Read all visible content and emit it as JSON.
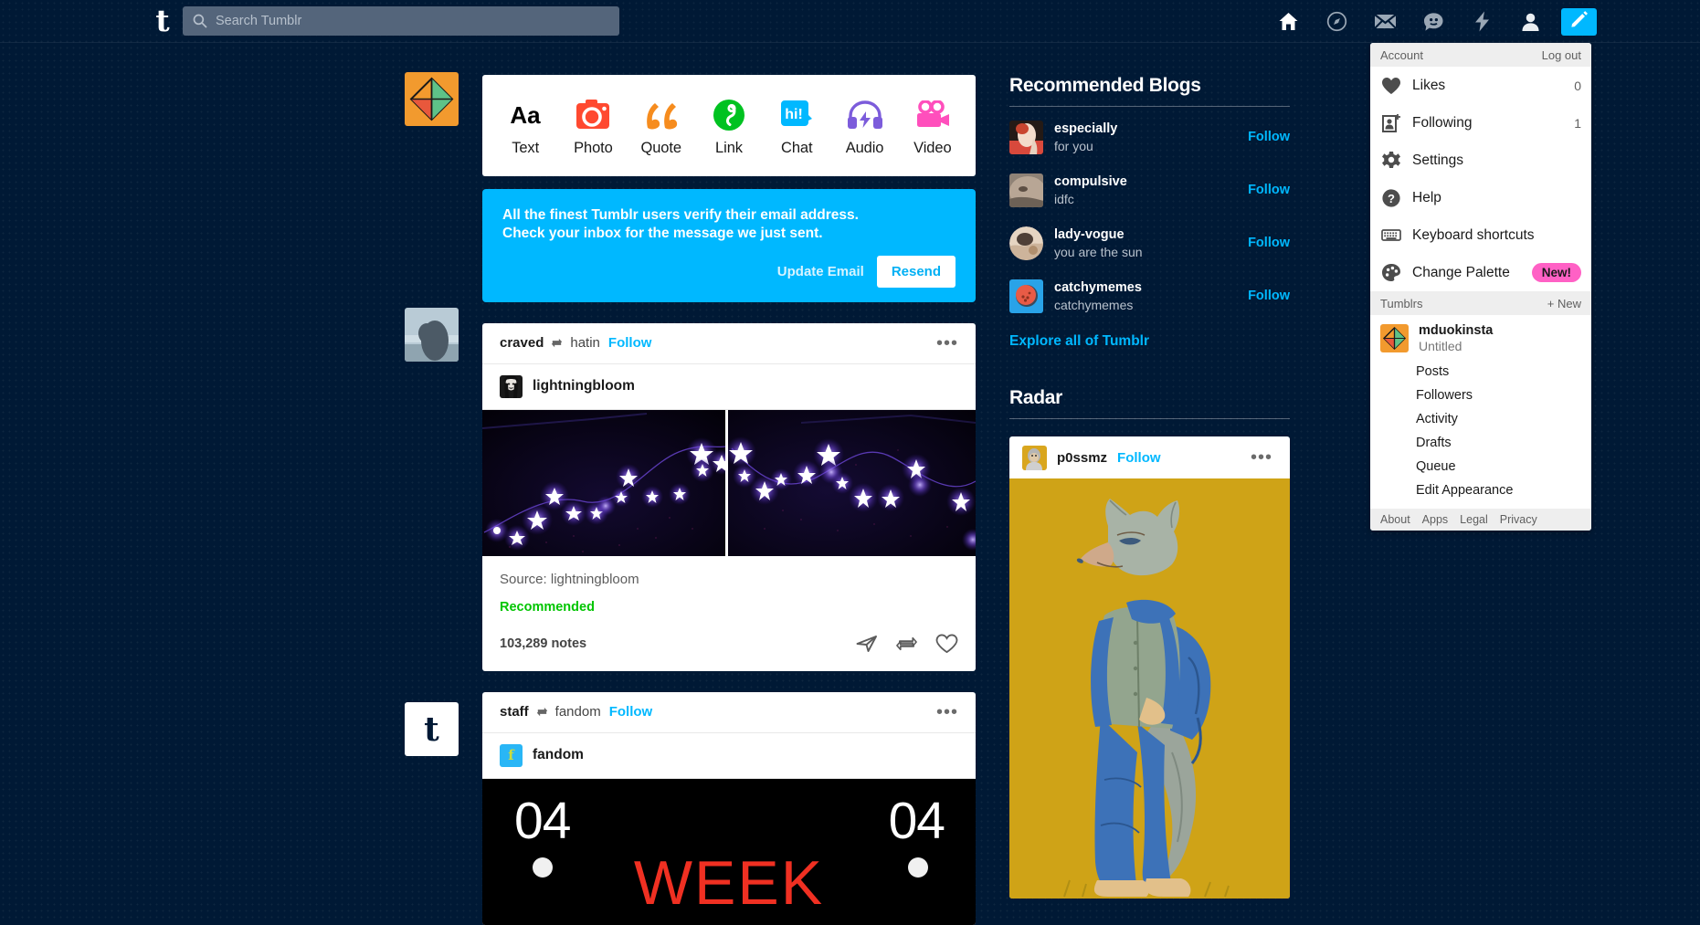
{
  "topbar": {
    "logo": "t",
    "search": {
      "placeholder": "Search Tumblr",
      "value": ""
    },
    "nav": [
      {
        "name": "home-icon",
        "label": "Home"
      },
      {
        "name": "explore-compass-icon",
        "label": "Explore"
      },
      {
        "name": "inbox-envelope-icon",
        "label": "Inbox"
      },
      {
        "name": "messaging-chat-icon",
        "label": "Messaging"
      },
      {
        "name": "activity-bolt-icon",
        "label": "Activity"
      },
      {
        "name": "account-person-icon",
        "label": "Account"
      }
    ],
    "compose_button": {
      "name": "compose-pencil-icon",
      "label": "Compose"
    }
  },
  "post_types": [
    {
      "label": "Text",
      "icon": "text-aa-icon",
      "color": "#000000"
    },
    {
      "label": "Photo",
      "icon": "photo-camera-icon",
      "color": "#ff4930"
    },
    {
      "label": "Quote",
      "icon": "quote-marks-icon",
      "color": "#f68c1e"
    },
    {
      "label": "Link",
      "icon": "link-chain-icon",
      "color": "#00c221"
    },
    {
      "label": "Chat",
      "icon": "chat-hi-icon",
      "color": "#00b8ff"
    },
    {
      "label": "Audio",
      "icon": "audio-headphones-icon",
      "color": "#7c5cdb"
    },
    {
      "label": "Video",
      "icon": "video-camera-icon",
      "color": "#ff4fbc"
    }
  ],
  "banner": {
    "message": "All the finest Tumblr users verify their email address. Check your inbox for the message we just sent.",
    "update_label": "Update Email",
    "resend_label": "Resend",
    "color": "#00b8ff"
  },
  "posts": [
    {
      "blog": "craved",
      "reblog_source": "hatin",
      "follow_label": "Follow",
      "author": "lightningbloom",
      "source_label": "Source: lightningbloom",
      "tag": "Recommended",
      "tag_color": "#00c500",
      "notes": "103,289 notes",
      "menu": "•••"
    },
    {
      "blog": "staff",
      "reblog_source": "fandom",
      "follow_label": "Follow",
      "author": "fandom",
      "image_left_number": "04",
      "image_right_number": "04",
      "image_word": "WEEK",
      "menu": "•••"
    }
  ],
  "right_column": {
    "recommended_title": "Recommended Blogs",
    "blogs": [
      {
        "name": "especially",
        "desc": "for you",
        "follow": "Follow"
      },
      {
        "name": "compulsive",
        "desc": "idfc",
        "follow": "Follow"
      },
      {
        "name": "lady-vogue",
        "desc": "you are the sun",
        "follow": "Follow"
      },
      {
        "name": "catchymemes",
        "desc": "catchymemes",
        "follow": "Follow"
      }
    ],
    "explore_link": "Explore all of Tumblr",
    "radar_title": "Radar",
    "radar": {
      "blog": "p0ssmz",
      "follow": "Follow",
      "menu": "•••"
    }
  },
  "account_menu": {
    "header_left": "Account",
    "header_right": "Log out",
    "items": [
      {
        "label": "Likes",
        "icon": "heart-icon",
        "count": "0"
      },
      {
        "label": "Following",
        "icon": "follow-person-icon",
        "count": "1"
      },
      {
        "label": "Settings",
        "icon": "gear-icon",
        "count": ""
      },
      {
        "label": "Help",
        "icon": "question-circle-icon",
        "count": ""
      },
      {
        "label": "Keyboard shortcuts",
        "icon": "keyboard-icon",
        "count": ""
      },
      {
        "label": "Change Palette",
        "icon": "palette-icon",
        "count": "",
        "badge": "New!"
      }
    ],
    "tumblrs_label": "Tumblrs",
    "new_label": "+ New",
    "blog": {
      "name": "mduokinsta",
      "title": "Untitled"
    },
    "blog_links": [
      "Posts",
      "Followers",
      "Activity",
      "Drafts",
      "Queue",
      "Edit Appearance"
    ],
    "footer_links": [
      "About",
      "Apps",
      "Legal",
      "Privacy"
    ],
    "badge_color": "#ff61c5"
  }
}
